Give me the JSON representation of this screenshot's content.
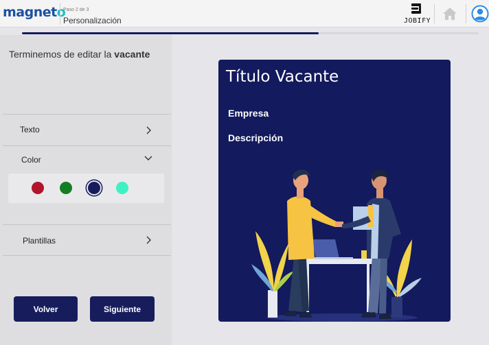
{
  "header": {
    "logo_text": "magneto",
    "step_text": "Paso 2 de 3",
    "step_title": "Personalización",
    "jobify_text": "JOBIFY"
  },
  "progress": {
    "fraction": 0.65
  },
  "left_panel": {
    "title_prefix": "Terminemos de editar la ",
    "title_bold": "vacante",
    "sections": [
      {
        "label": "Texto",
        "expanded": false
      },
      {
        "label": "Color",
        "expanded": true
      },
      {
        "label": "Plantillas",
        "expanded": false
      }
    ],
    "colors": [
      {
        "hex": "#b2142c",
        "selected": false
      },
      {
        "hex": "#137d24",
        "selected": false
      },
      {
        "hex": "#161c5c",
        "selected": true
      },
      {
        "hex": "#3ef1c3",
        "selected": false
      }
    ],
    "back_label": "Volver",
    "next_label": "Siguiente"
  },
  "preview": {
    "title": "Título Vacante",
    "company": "Empresa",
    "description": "Descripción",
    "background_color": "#131a5d"
  },
  "icons": [
    "jobify-logo-icon",
    "home-icon",
    "user-avatar-icon",
    "chevron-right-icon",
    "chevron-down-icon"
  ]
}
